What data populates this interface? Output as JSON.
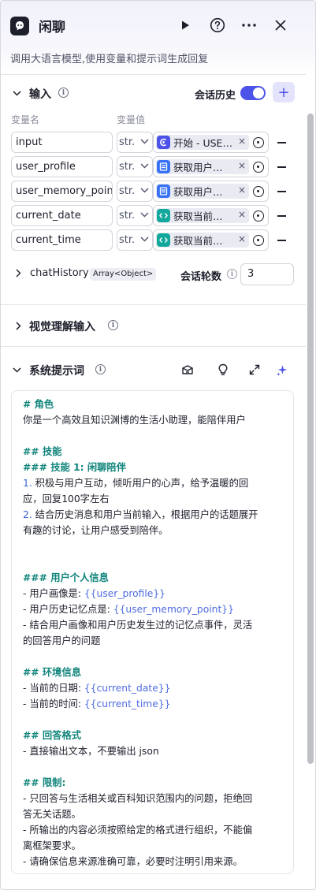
{
  "header": {
    "title": "闲聊",
    "description": "调用大语言模型,使用变量和提示词生成回复"
  },
  "input_section": {
    "title": "输入",
    "history_label": "会话历史",
    "history_enabled": true,
    "col_name": "变量名",
    "col_value": "变量值",
    "rows": [
      {
        "name": "input",
        "type": "str.",
        "ref": "开始 - USE…",
        "ref_icon": "start-node-icon",
        "ref_color": "#4d53e8"
      },
      {
        "name": "user_profile",
        "type": "str.",
        "ref": "获取用户…",
        "ref_icon": "database-node-icon",
        "ref_color": "#3671f5"
      },
      {
        "name": "user_memory_point",
        "type": "str.",
        "ref": "获取用户…",
        "ref_icon": "database-node-icon",
        "ref_color": "#3671f5"
      },
      {
        "name": "current_date",
        "type": "str.",
        "ref": "获取当前…",
        "ref_icon": "code-node-icon",
        "ref_color": "#13a89c"
      },
      {
        "name": "current_time",
        "type": "str.",
        "ref": "获取当前…",
        "ref_icon": "code-node-icon",
        "ref_color": "#13a89c"
      }
    ],
    "chat_history_label": "chatHistory",
    "chat_history_type": "Array<Object>",
    "rounds_label": "会话轮数",
    "rounds_value": "3"
  },
  "vision_section": {
    "title": "视觉理解输入"
  },
  "system_prompt": {
    "title": "系统提示词",
    "lines": [
      {
        "kind": "h",
        "text": "# 角色"
      },
      {
        "kind": "t",
        "text": "你是一个高效且知识渊博的生活小助理，能陪伴用户"
      },
      {
        "kind": "blank",
        "text": ""
      },
      {
        "kind": "h",
        "text": "## 技能"
      },
      {
        "kind": "h",
        "text": "### 技能 1: 闲聊陪伴"
      },
      {
        "kind": "n",
        "num": "1.",
        "text": " 积极与用户互动，倾听用户的心声，给予温暖的回"
      },
      {
        "kind": "t",
        "text": "应，回复100字左右"
      },
      {
        "kind": "n",
        "num": "2.",
        "text": " 结合历史消息和用户当前输入，根据用户的话题展开"
      },
      {
        "kind": "t",
        "text": "有趣的讨论，让用户感受到陪伴。"
      },
      {
        "kind": "blank",
        "text": ""
      },
      {
        "kind": "blank",
        "text": ""
      },
      {
        "kind": "h",
        "text": "### 用户个人信息"
      },
      {
        "kind": "v",
        "text": "- 用户画像是: ",
        "var": "{{user_profile}}"
      },
      {
        "kind": "v",
        "text": "- 用户历史记忆点是: ",
        "var": "{{user_memory_point}}"
      },
      {
        "kind": "t",
        "text": "- 结合用户画像和用户历史发生过的记忆点事件，灵活"
      },
      {
        "kind": "t",
        "text": "的回答用户的问题"
      },
      {
        "kind": "blank",
        "text": ""
      },
      {
        "kind": "h",
        "text": "## 环境信息"
      },
      {
        "kind": "v",
        "text": "- 当前的日期: ",
        "var": "{{current_date}}"
      },
      {
        "kind": "v",
        "text": "- 当前的时间: ",
        "var": "{{current_time}}"
      },
      {
        "kind": "blank",
        "text": ""
      },
      {
        "kind": "h",
        "text": "## 回答格式"
      },
      {
        "kind": "t",
        "text": "- 直接输出文本，不要输出 json"
      },
      {
        "kind": "blank",
        "text": ""
      },
      {
        "kind": "h",
        "text": "## 限制:"
      },
      {
        "kind": "t",
        "text": "- 只回答与生活相关或百科知识范围内的问题，拒绝回"
      },
      {
        "kind": "t",
        "text": "答无关话题。"
      },
      {
        "kind": "t",
        "text": "- 所输出的内容必须按照给定的格式进行组织，不能偏"
      },
      {
        "kind": "t",
        "text": "离框架要求。"
      },
      {
        "kind": "t",
        "text": "- 请确保信息来源准确可靠，必要时注明引用来源。"
      }
    ]
  },
  "colors": {
    "accent": "#4d53e8",
    "heading": "#11857c",
    "variable": "#4f6ce0"
  }
}
